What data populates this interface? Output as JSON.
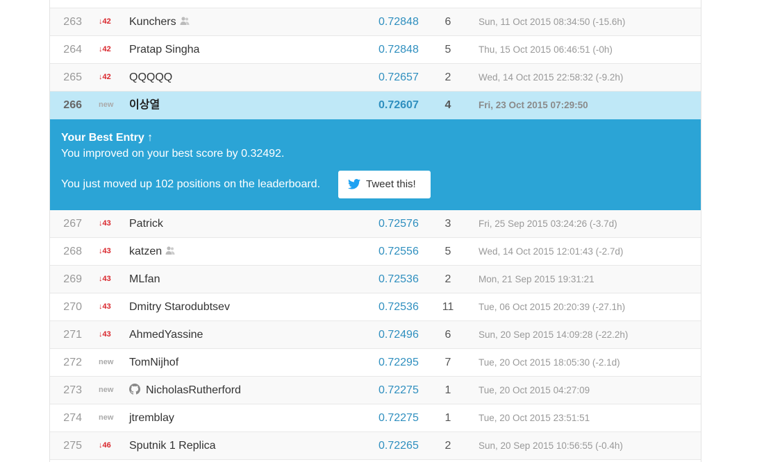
{
  "leaderboard": {
    "rows_before": [
      {
        "rank": "263",
        "delta": "↓42",
        "is_new": false,
        "name": "Kunchers",
        "team_icon": true,
        "github_icon": false,
        "score": "0.72848",
        "entries": "6",
        "time": "Sun, 11 Oct 2015 08:34:50 (-15.6h)"
      },
      {
        "rank": "264",
        "delta": "↓42",
        "is_new": false,
        "name": "Pratap Singha",
        "team_icon": false,
        "github_icon": false,
        "score": "0.72848",
        "entries": "5",
        "time": "Thu, 15 Oct 2015 06:46:51 (-0h)"
      },
      {
        "rank": "265",
        "delta": "↓42",
        "is_new": false,
        "name": "QQQQQ",
        "team_icon": false,
        "github_icon": false,
        "score": "0.72657",
        "entries": "2",
        "time": "Wed, 14 Oct 2015 22:58:32 (-9.2h)"
      }
    ],
    "my_row": {
      "rank": "266",
      "delta": "new",
      "is_new": true,
      "name": "이상열",
      "score": "0.72607",
      "entries": "4",
      "time": "Fri, 23 Oct 2015 07:29:50"
    },
    "rows_after": [
      {
        "rank": "267",
        "delta": "↓43",
        "is_new": false,
        "name": "Patrick",
        "team_icon": false,
        "github_icon": false,
        "score": "0.72576",
        "entries": "3",
        "time": "Fri, 25 Sep 2015 03:24:26 (-3.7d)"
      },
      {
        "rank": "268",
        "delta": "↓43",
        "is_new": false,
        "name": "katzen",
        "team_icon": true,
        "github_icon": false,
        "score": "0.72556",
        "entries": "5",
        "time": "Wed, 14 Oct 2015 12:01:43 (-2.7d)"
      },
      {
        "rank": "269",
        "delta": "↓43",
        "is_new": false,
        "name": "MLfan",
        "team_icon": false,
        "github_icon": false,
        "score": "0.72536",
        "entries": "2",
        "time": "Mon, 21 Sep 2015 19:31:21"
      },
      {
        "rank": "270",
        "delta": "↓43",
        "is_new": false,
        "name": "Dmitry Starodubtsev",
        "team_icon": false,
        "github_icon": false,
        "score": "0.72536",
        "entries": "11",
        "time": "Tue, 06 Oct 2015 20:20:39 (-27.1h)"
      },
      {
        "rank": "271",
        "delta": "↓43",
        "is_new": false,
        "name": "AhmedYassine",
        "team_icon": false,
        "github_icon": false,
        "score": "0.72496",
        "entries": "6",
        "time": "Sun, 20 Sep 2015 14:09:28 (-22.2h)"
      },
      {
        "rank": "272",
        "delta": "new",
        "is_new": true,
        "name": "TomNijhof",
        "team_icon": false,
        "github_icon": false,
        "score": "0.72295",
        "entries": "7",
        "time": "Tue, 20 Oct 2015 18:05:30 (-2.1d)"
      },
      {
        "rank": "273",
        "delta": "new",
        "is_new": true,
        "name": "NicholasRutherford",
        "team_icon": false,
        "github_icon": true,
        "score": "0.72275",
        "entries": "1",
        "time": "Tue, 20 Oct 2015 04:27:09"
      },
      {
        "rank": "274",
        "delta": "new",
        "is_new": true,
        "name": "jtremblay",
        "team_icon": false,
        "github_icon": false,
        "score": "0.72275",
        "entries": "1",
        "time": "Tue, 20 Oct 2015 23:51:51"
      },
      {
        "rank": "275",
        "delta": "↓46",
        "is_new": false,
        "name": "Sputnik 1 Replica",
        "team_icon": false,
        "github_icon": false,
        "score": "0.72265",
        "entries": "2",
        "time": "Sun, 20 Sep 2015 10:56:55 (-0.4h)"
      }
    ]
  },
  "banner": {
    "title": "Your Best Entry ↑",
    "improved_text": "You improved on your best score by 0.32492.",
    "moved_text": "You just moved up 102 positions on the leaderboard.",
    "tweet_label": "Tweet this!",
    "tweet_icon": "twitter-bird-icon"
  },
  "colors": {
    "highlight_row": "#bfe8f7",
    "banner_bg": "#2ba4d6",
    "score": "#2f8fbf",
    "delta_down": "#d9262c",
    "twitter_blue": "#1da1f2"
  }
}
